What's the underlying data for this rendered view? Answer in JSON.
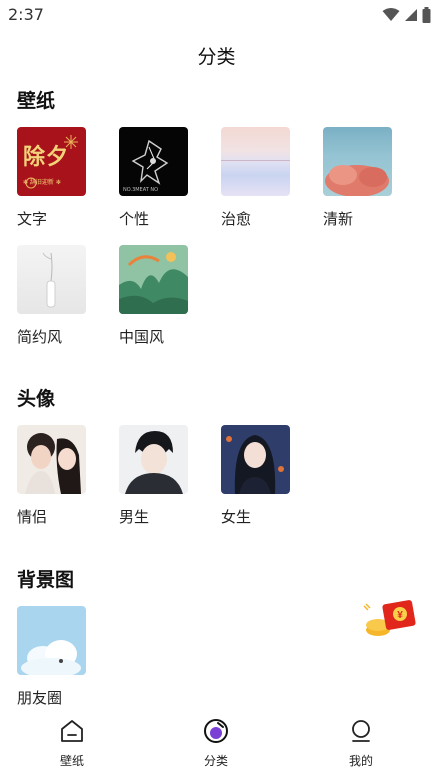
{
  "status": {
    "time": "2:37"
  },
  "header": {
    "title": "分类"
  },
  "sections": [
    {
      "title": "壁纸",
      "items": [
        {
          "label": "文字",
          "thumb_text": "除夕",
          "thumb_subtext": "✻ 辞旧迎新 ✻"
        },
        {
          "label": "个性",
          "thumb_text": "NO.3MEAT NO"
        },
        {
          "label": "治愈"
        },
        {
          "label": "清新"
        },
        {
          "label": "简约风"
        },
        {
          "label": "中国风"
        }
      ]
    },
    {
      "title": "头像",
      "items": [
        {
          "label": "情侣"
        },
        {
          "label": "男生"
        },
        {
          "label": "女生"
        }
      ]
    },
    {
      "title": "背景图",
      "items": [
        {
          "label": "朋友圈"
        }
      ]
    }
  ],
  "redpacket": {
    "symbol": "¥"
  },
  "nav": [
    {
      "label": "壁纸",
      "icon": "home-icon",
      "active": false
    },
    {
      "label": "分类",
      "icon": "category-icon",
      "active": true
    },
    {
      "label": "我的",
      "icon": "profile-icon",
      "active": false
    }
  ],
  "colors": {
    "accent": "#7b3fd6",
    "text": "#222222",
    "redpacket": "#e1261c"
  }
}
